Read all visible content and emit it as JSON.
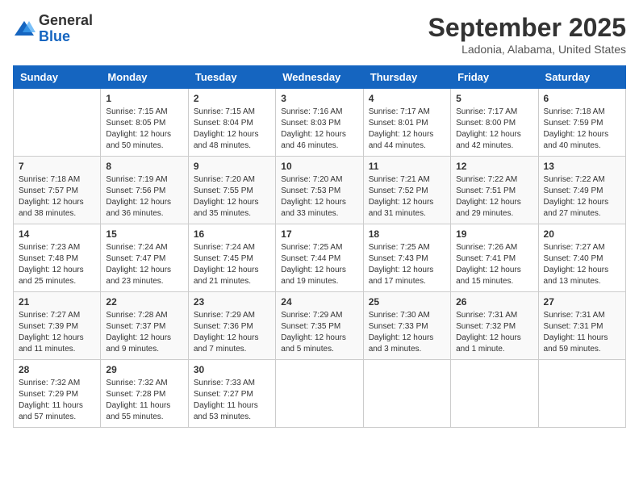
{
  "logo": {
    "general": "General",
    "blue": "Blue"
  },
  "header": {
    "month": "September 2025",
    "location": "Ladonia, Alabama, United States"
  },
  "weekdays": [
    "Sunday",
    "Monday",
    "Tuesday",
    "Wednesday",
    "Thursday",
    "Friday",
    "Saturday"
  ],
  "weeks": [
    [
      {
        "day": "",
        "content": ""
      },
      {
        "day": "1",
        "content": "Sunrise: 7:15 AM\nSunset: 8:05 PM\nDaylight: 12 hours\nand 50 minutes."
      },
      {
        "day": "2",
        "content": "Sunrise: 7:15 AM\nSunset: 8:04 PM\nDaylight: 12 hours\nand 48 minutes."
      },
      {
        "day": "3",
        "content": "Sunrise: 7:16 AM\nSunset: 8:03 PM\nDaylight: 12 hours\nand 46 minutes."
      },
      {
        "day": "4",
        "content": "Sunrise: 7:17 AM\nSunset: 8:01 PM\nDaylight: 12 hours\nand 44 minutes."
      },
      {
        "day": "5",
        "content": "Sunrise: 7:17 AM\nSunset: 8:00 PM\nDaylight: 12 hours\nand 42 minutes."
      },
      {
        "day": "6",
        "content": "Sunrise: 7:18 AM\nSunset: 7:59 PM\nDaylight: 12 hours\nand 40 minutes."
      }
    ],
    [
      {
        "day": "7",
        "content": "Sunrise: 7:18 AM\nSunset: 7:57 PM\nDaylight: 12 hours\nand 38 minutes."
      },
      {
        "day": "8",
        "content": "Sunrise: 7:19 AM\nSunset: 7:56 PM\nDaylight: 12 hours\nand 36 minutes."
      },
      {
        "day": "9",
        "content": "Sunrise: 7:20 AM\nSunset: 7:55 PM\nDaylight: 12 hours\nand 35 minutes."
      },
      {
        "day": "10",
        "content": "Sunrise: 7:20 AM\nSunset: 7:53 PM\nDaylight: 12 hours\nand 33 minutes."
      },
      {
        "day": "11",
        "content": "Sunrise: 7:21 AM\nSunset: 7:52 PM\nDaylight: 12 hours\nand 31 minutes."
      },
      {
        "day": "12",
        "content": "Sunrise: 7:22 AM\nSunset: 7:51 PM\nDaylight: 12 hours\nand 29 minutes."
      },
      {
        "day": "13",
        "content": "Sunrise: 7:22 AM\nSunset: 7:49 PM\nDaylight: 12 hours\nand 27 minutes."
      }
    ],
    [
      {
        "day": "14",
        "content": "Sunrise: 7:23 AM\nSunset: 7:48 PM\nDaylight: 12 hours\nand 25 minutes."
      },
      {
        "day": "15",
        "content": "Sunrise: 7:24 AM\nSunset: 7:47 PM\nDaylight: 12 hours\nand 23 minutes."
      },
      {
        "day": "16",
        "content": "Sunrise: 7:24 AM\nSunset: 7:45 PM\nDaylight: 12 hours\nand 21 minutes."
      },
      {
        "day": "17",
        "content": "Sunrise: 7:25 AM\nSunset: 7:44 PM\nDaylight: 12 hours\nand 19 minutes."
      },
      {
        "day": "18",
        "content": "Sunrise: 7:25 AM\nSunset: 7:43 PM\nDaylight: 12 hours\nand 17 minutes."
      },
      {
        "day": "19",
        "content": "Sunrise: 7:26 AM\nSunset: 7:41 PM\nDaylight: 12 hours\nand 15 minutes."
      },
      {
        "day": "20",
        "content": "Sunrise: 7:27 AM\nSunset: 7:40 PM\nDaylight: 12 hours\nand 13 minutes."
      }
    ],
    [
      {
        "day": "21",
        "content": "Sunrise: 7:27 AM\nSunset: 7:39 PM\nDaylight: 12 hours\nand 11 minutes."
      },
      {
        "day": "22",
        "content": "Sunrise: 7:28 AM\nSunset: 7:37 PM\nDaylight: 12 hours\nand 9 minutes."
      },
      {
        "day": "23",
        "content": "Sunrise: 7:29 AM\nSunset: 7:36 PM\nDaylight: 12 hours\nand 7 minutes."
      },
      {
        "day": "24",
        "content": "Sunrise: 7:29 AM\nSunset: 7:35 PM\nDaylight: 12 hours\nand 5 minutes."
      },
      {
        "day": "25",
        "content": "Sunrise: 7:30 AM\nSunset: 7:33 PM\nDaylight: 12 hours\nand 3 minutes."
      },
      {
        "day": "26",
        "content": "Sunrise: 7:31 AM\nSunset: 7:32 PM\nDaylight: 12 hours\nand 1 minute."
      },
      {
        "day": "27",
        "content": "Sunrise: 7:31 AM\nSunset: 7:31 PM\nDaylight: 11 hours\nand 59 minutes."
      }
    ],
    [
      {
        "day": "28",
        "content": "Sunrise: 7:32 AM\nSunset: 7:29 PM\nDaylight: 11 hours\nand 57 minutes."
      },
      {
        "day": "29",
        "content": "Sunrise: 7:32 AM\nSunset: 7:28 PM\nDaylight: 11 hours\nand 55 minutes."
      },
      {
        "day": "30",
        "content": "Sunrise: 7:33 AM\nSunset: 7:27 PM\nDaylight: 11 hours\nand 53 minutes."
      },
      {
        "day": "",
        "content": ""
      },
      {
        "day": "",
        "content": ""
      },
      {
        "day": "",
        "content": ""
      },
      {
        "day": "",
        "content": ""
      }
    ]
  ]
}
